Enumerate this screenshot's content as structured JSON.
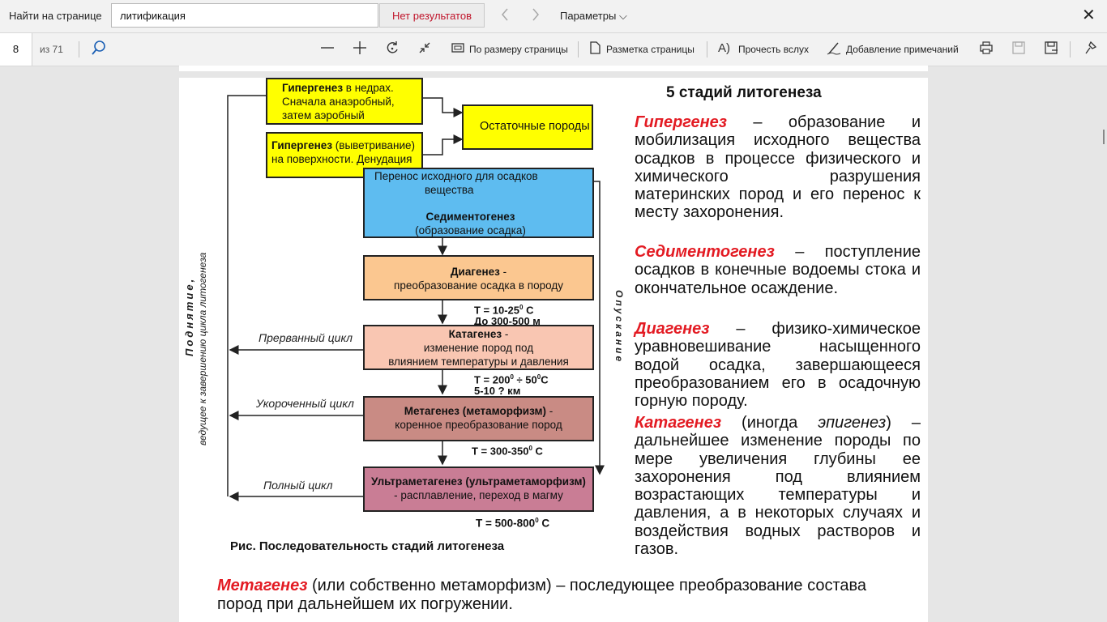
{
  "find_bar": {
    "label": "Найти на странице",
    "query": "литификация",
    "result": "Нет результатов",
    "prev_icon": "chevron-left-icon",
    "next_icon": "chevron-right-icon",
    "options": "Параметры",
    "options_chevron": "⌵",
    "close": "✕"
  },
  "toolbar": {
    "page_number": "8",
    "page_total": "из 71",
    "fit_page": "По размеру страницы",
    "page_layout": "Разметка страницы",
    "read_aloud": "Прочесть вслух",
    "add_notes": "Добавление примечаний"
  },
  "diagram": {
    "hyper_deep": [
      "Гипергенез",
      " в недрах.",
      "Сначала анаэробный,",
      "затем аэробный"
    ],
    "residual": "Остаточные породы",
    "hyper_surface": [
      "Гипергенез",
      " (выветривание)",
      "на поверхности. Денудация"
    ],
    "transfer": [
      "Перенос исходного для осадков",
      "вещества"
    ],
    "sedimentogenesis": [
      "Седиментогенез",
      "(образование осадка)"
    ],
    "diagenesis": [
      "Диагенез",
      " -",
      "преобразование осадка в породу"
    ],
    "diagenesis_temp": [
      "T = 10-25",
      "0",
      " C"
    ],
    "diagenesis_depth": "До 300-500 м",
    "catagenesis": [
      "Катагенез",
      " -",
      "изменение пород под",
      "влиянием температуры и давления"
    ],
    "catagenesis_temp": [
      "T = 200",
      "0",
      " ÷ 50",
      "0",
      "C"
    ],
    "catagenesis_depth": "5-10 ? км",
    "metagenesis": [
      "Метагенез (метаморфизм)",
      " -",
      "коренное преобразование пород"
    ],
    "metagenesis_temp": [
      "T = 300-350",
      "0",
      " C"
    ],
    "ultrameta": [
      "Ультраметагенез (ультраметаморфизм)",
      "- расплавление, переход в магму"
    ],
    "ultrameta_temp": [
      "T = 500-800",
      "0",
      " C"
    ],
    "cycle_interrupted": "Прерванный цикл",
    "cycle_short": "Укороченный цикл",
    "cycle_full": "Полный цикл",
    "uplift": "Поднятие,",
    "uplift_sub": "ведущее к завершению цикла литогенеза",
    "subsidence": "Опускание",
    "caption": "Рис. Последовательность стадий литогенеза"
  },
  "text": {
    "title": "5 стадий литогенеза",
    "p1_term": "Гипергенез",
    "p1_body": " – образование и мобилизация исходного вещества осадков в процессе физического и химического разрушения материнских пород и его перенос к месту захоронения.",
    "p2_term": "Седиментогенез",
    "p2_body": " – поступление осадков в конечные водоемы стока и окончательное осаждение.",
    "p3_term": "Диагенез",
    "p3_body": " – физико-химическое уравновешивание насыщенного водой осадка, завершающееся преобразованием его в осадочную горную породу.",
    "p4_term": "Катагенез",
    "p4_mid": " (иногда ",
    "p4_italic": "эпигенез",
    "p4_body": ") – дальнейшее изменение породы по мере увеличения глубины ее захоронения под влиянием возрастающих температуры и давления, а в некоторых случаях и воздействия водных растворов и газов.",
    "p5_term": "Метагенез",
    "p5_body": " (или собственно метаморфизм) – последующее преобразование состава пород при дальнейшем их погружении."
  },
  "colors": {
    "yellow": "#ffff00",
    "blue": "#5ebcf0",
    "diagenesis": "#fbc790",
    "catagenesis": "#f9c6b2",
    "metagenesis": "#c98b84",
    "ultrameta": "#c97d95",
    "term_red": "#e31b23"
  }
}
